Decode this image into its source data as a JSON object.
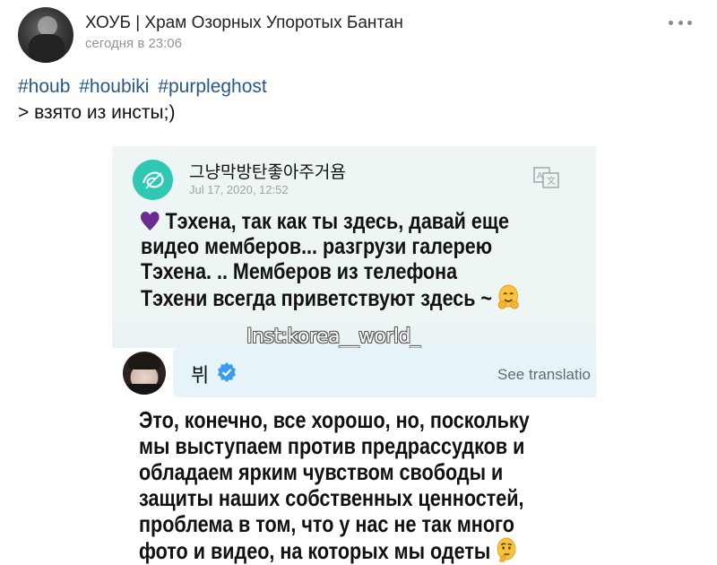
{
  "post": {
    "group_name": "ХОУБ | Храм Озорных Упоротых Бантан",
    "time": "сегодня в 23:06",
    "hashtags": [
      "#houb",
      "#houbiki",
      "#purpleghost"
    ],
    "text": "> взято из инсты;)",
    "avatar_icon": "group-avatar",
    "more_icon": "more-dots-icon"
  },
  "photo": {
    "card1": {
      "name": "그냥막방탄좋아주거욤",
      "date": "Jul 17, 2020, 12:52",
      "translate_icon": "translate-icon",
      "lines": [
        "Тэхена, так как ты здесь, давай еще",
        "видео мемберов... разгрузи галерею",
        "Тэхена. .. Мемберов из телефона",
        "Тэхени всегда приветствуют здесь ~"
      ],
      "heart_color": "#6a2c91"
    },
    "watermark": "Inst:korea__world_",
    "card2": {
      "name": "뷔",
      "see_translation": "See translatio",
      "lines": [
        "Это, конечно, все хорошо, но, поскольку",
        "мы выступаем против предрассудков и",
        "обладаем ярким чувством свободы и",
        "защиты наших собственных ценностей,",
        "проблема в том, что у нас не так много",
        "фото и видео, на которых мы одеты"
      ]
    }
  },
  "colors": {
    "link": "#2a5885",
    "meta": "#939393",
    "logo": "#31c8b3",
    "verified": "#3b9bf0"
  }
}
